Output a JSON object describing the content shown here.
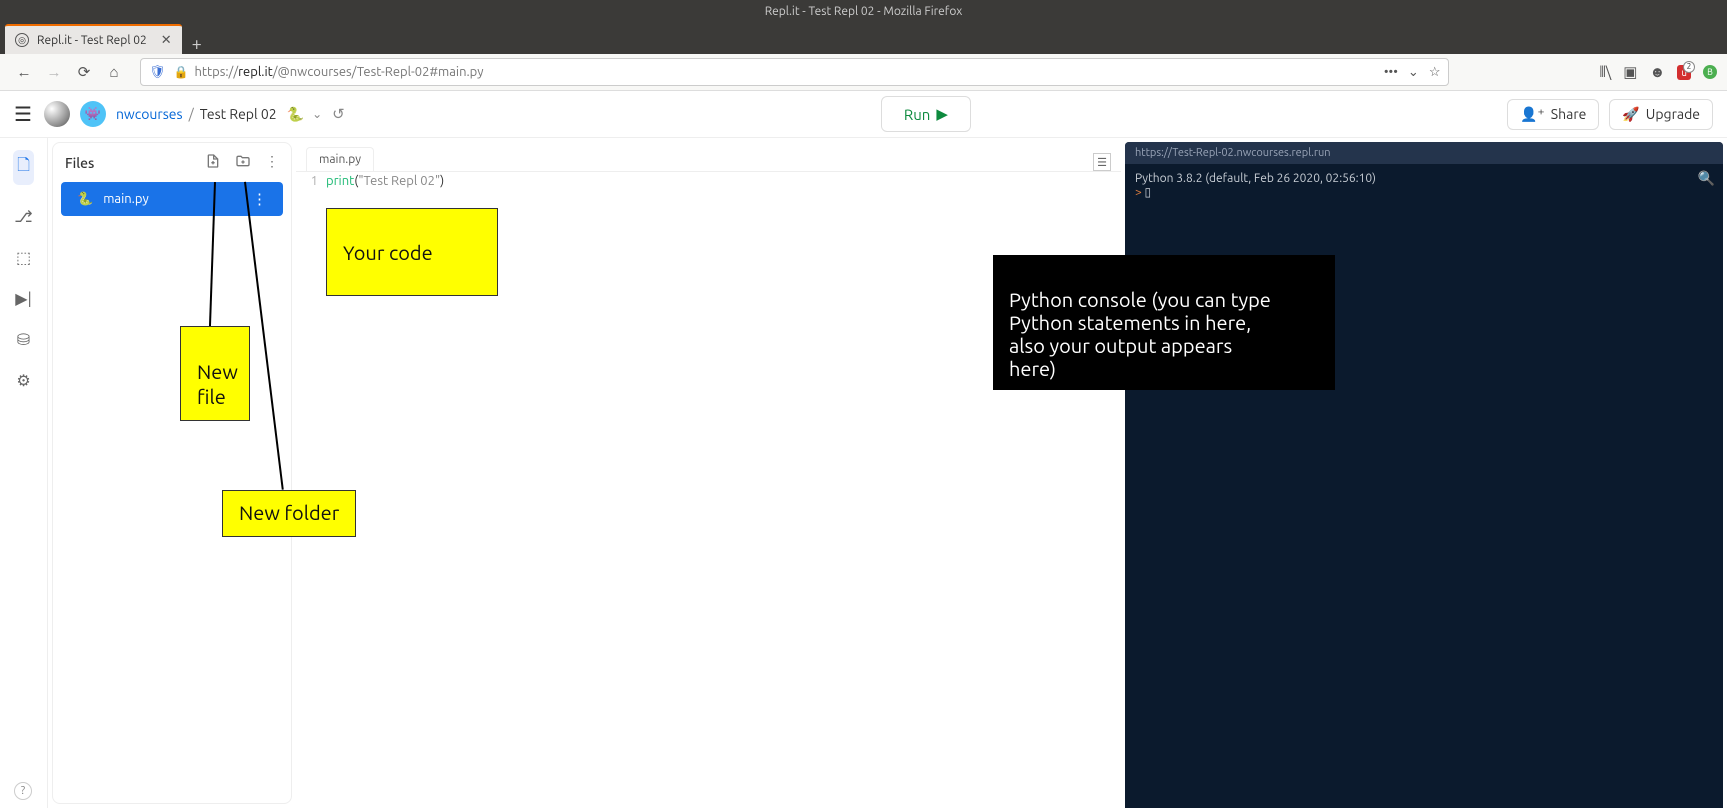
{
  "window": {
    "title": "Repl.it - Test Repl 02 - Mozilla Firefox"
  },
  "tab": {
    "title": "Repl.it - Test Repl 02"
  },
  "url": {
    "protocol": "https://",
    "host": "repl.it",
    "path": "/@nwcourses/Test-Repl-02#main.py"
  },
  "app_header": {
    "user": "nwcourses",
    "repl_name": "Test Repl 02",
    "run_label": "Run",
    "share_label": "Share",
    "upgrade_label": "Upgrade"
  },
  "files_panel": {
    "title": "Files",
    "file": "main.py"
  },
  "editor": {
    "tab": "main.py",
    "line_number": "1",
    "code_fn": "print",
    "code_paren_open": "(",
    "code_string": "\"Test Repl 02\"",
    "code_paren_close": ")"
  },
  "console": {
    "url": "https://Test-Repl-02.nwcourses.repl.run",
    "line1": "Python 3.8.2 (default, Feb 26 2020, 02:56:10)",
    "prompt": ">"
  },
  "annotations": {
    "your_code": "Your code",
    "new_file": "New\nfile",
    "new_folder": "New folder",
    "console_note": "Python console (you can type\nPython statements in here,\nalso your output appears\nhere)"
  }
}
